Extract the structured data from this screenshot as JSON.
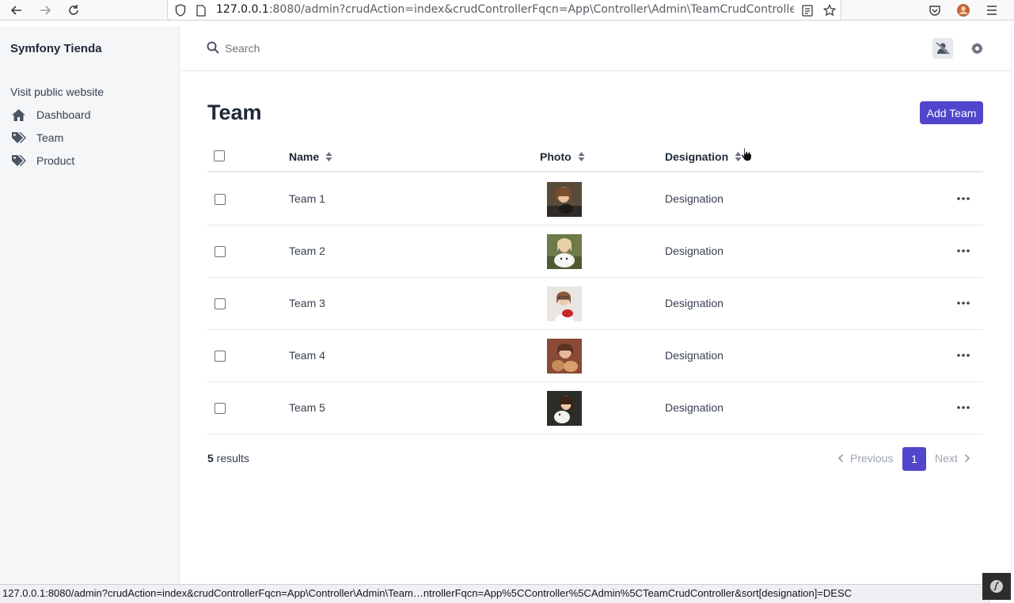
{
  "browser": {
    "url_host": "127.0.0.1",
    "url_rest": ":8080/admin?crudAction=index&crudControllerFqcn=App\\Controller\\Admin\\TeamCrudControlle"
  },
  "sidebar": {
    "brand": "Symfony Tienda",
    "public_link": "Visit public website",
    "items": [
      {
        "label": "Dashboard",
        "icon": "home-icon"
      },
      {
        "label": "Team",
        "icon": "tags-icon"
      },
      {
        "label": "Product",
        "icon": "tags-icon"
      }
    ]
  },
  "header": {
    "search_placeholder": "Search"
  },
  "main": {
    "title": "Team",
    "add_button": "Add Team",
    "columns": [
      "Name",
      "Photo",
      "Designation"
    ],
    "rows": [
      {
        "name": "Team 1",
        "designation": "Designation"
      },
      {
        "name": "Team 2",
        "designation": "Designation"
      },
      {
        "name": "Team 3",
        "designation": "Designation"
      },
      {
        "name": "Team 4",
        "designation": "Designation"
      },
      {
        "name": "Team 5",
        "designation": "Designation"
      }
    ],
    "results_count": "5",
    "results_label": " results",
    "pager": {
      "prev": "Previous",
      "page": "1",
      "next": "Next"
    }
  },
  "status_bar": "127.0.0.1:8080/admin?crudAction=index&crudControllerFqcn=App\\Controller\\Admin\\Team…ntrollerFqcn=App%5CController%5CAdmin%5CTeamCrudController&sort[designation]=DESC",
  "colors": {
    "accent": "#5145cd",
    "sidebar_bg": "#f5f6f8"
  }
}
